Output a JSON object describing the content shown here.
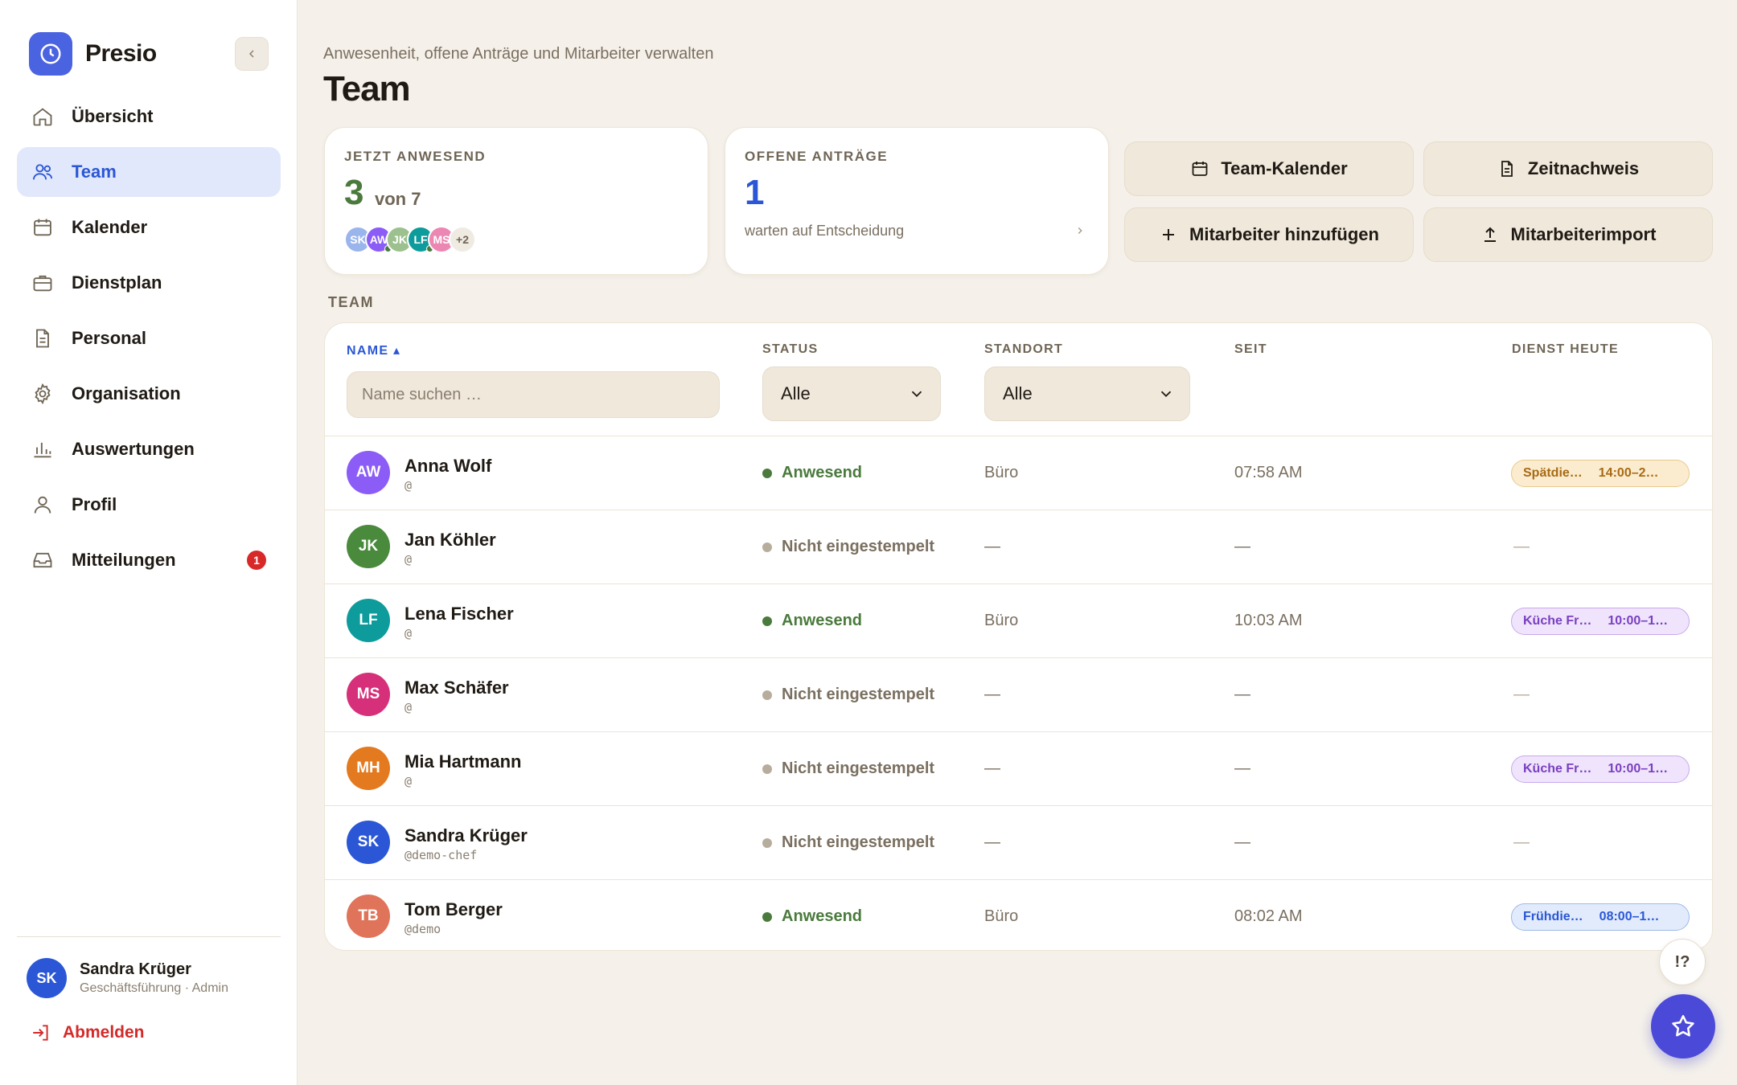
{
  "app": {
    "name": "Presio"
  },
  "nav": [
    {
      "label": "Übersicht",
      "icon": "home-icon"
    },
    {
      "label": "Team",
      "icon": "users-icon",
      "active": true
    },
    {
      "label": "Kalender",
      "icon": "calendar-icon"
    },
    {
      "label": "Dienstplan",
      "icon": "briefcase-icon"
    },
    {
      "label": "Personal",
      "icon": "document-icon"
    },
    {
      "label": "Organisation",
      "icon": "gear-icon"
    },
    {
      "label": "Auswertungen",
      "icon": "bar-chart-icon"
    },
    {
      "label": "Profil",
      "icon": "user-icon"
    },
    {
      "label": "Mitteilungen",
      "icon": "inbox-icon",
      "badge": "1"
    }
  ],
  "user": {
    "initials": "SK",
    "name": "Sandra Krüger",
    "role": "Geschäftsführung · Admin"
  },
  "logout_label": "Abmelden",
  "header": {
    "subtitle": "Anwesenheit, offene Anträge und Mitarbeiter verwalten",
    "title": "Team"
  },
  "stats": {
    "present": {
      "label": "JETZT ANWESEND",
      "value": "3",
      "of": "von 7",
      "avatars": [
        "SK",
        "AW",
        "JK",
        "LF",
        "MS"
      ],
      "more": "+2"
    },
    "pending": {
      "label": "OFFENE ANTRÄGE",
      "value": "1",
      "sub": "warten auf Entscheidung"
    }
  },
  "actions": {
    "calendar": "Team-Kalender",
    "timesheet": "Zeitnachweis",
    "add_employee": "Mitarbeiter hinzufügen",
    "import": "Mitarbeiterimport"
  },
  "section_label": "TEAM",
  "table": {
    "columns": {
      "name": "NAME ▴",
      "status": "STATUS",
      "location": "STANDORT",
      "since": "SEIT",
      "shift": "DIENST HEUTE"
    },
    "search_placeholder": "Name suchen …",
    "status_filter": "Alle",
    "location_filter": "Alle",
    "rows": [
      {
        "initials": "AW",
        "name": "Anna Wolf",
        "handle": "@",
        "status": "Anwesend",
        "location": "Büro",
        "since": "07:58 AM",
        "shift_name": "Spätdie…",
        "shift_time": "14:00–2…"
      },
      {
        "initials": "JK",
        "name": "Jan Köhler",
        "handle": "@",
        "status": "Nicht eingestempelt",
        "location": "—",
        "since": "—",
        "shift_empty": "—"
      },
      {
        "initials": "LF",
        "name": "Lena Fischer",
        "handle": "@",
        "status": "Anwesend",
        "location": "Büro",
        "since": "10:03 AM",
        "shift_name": "Küche Fr…",
        "shift_time": "10:00–1…"
      },
      {
        "initials": "MS",
        "name": "Max Schäfer",
        "handle": "@",
        "status": "Nicht eingestempelt",
        "location": "—",
        "since": "—",
        "shift_empty": "—"
      },
      {
        "initials": "MH",
        "name": "Mia Hartmann",
        "handle": "@",
        "status": "Nicht eingestempelt",
        "location": "—",
        "since": "—",
        "shift_name": "Küche Fr…",
        "shift_time": "10:00–1…"
      },
      {
        "initials": "SK",
        "name": "Sandra Krüger",
        "handle": "@demo-chef",
        "status": "Nicht eingestempelt",
        "location": "—",
        "since": "—",
        "shift_empty": "—"
      },
      {
        "initials": "TB",
        "name": "Tom Berger",
        "handle": "@demo",
        "status": "Anwesend",
        "location": "Büro",
        "since": "08:02 AM",
        "shift_name": "Frühdie…",
        "shift_time": "08:00–1…"
      }
    ]
  },
  "help_label": "!?",
  "colors": {
    "accent": "#2b57d6",
    "present": "#4a7a3c",
    "absent": "#b7ad9d",
    "avatar_aw": "#8b5cf6",
    "avatar_jk": "#4a8a3c",
    "avatar_lf": "#0e9b9b",
    "avatar_ms": "#d6307a",
    "avatar_mh": "#e47a20",
    "avatar_sk": "#2b57d6",
    "avatar_tb": "#e0745a"
  }
}
